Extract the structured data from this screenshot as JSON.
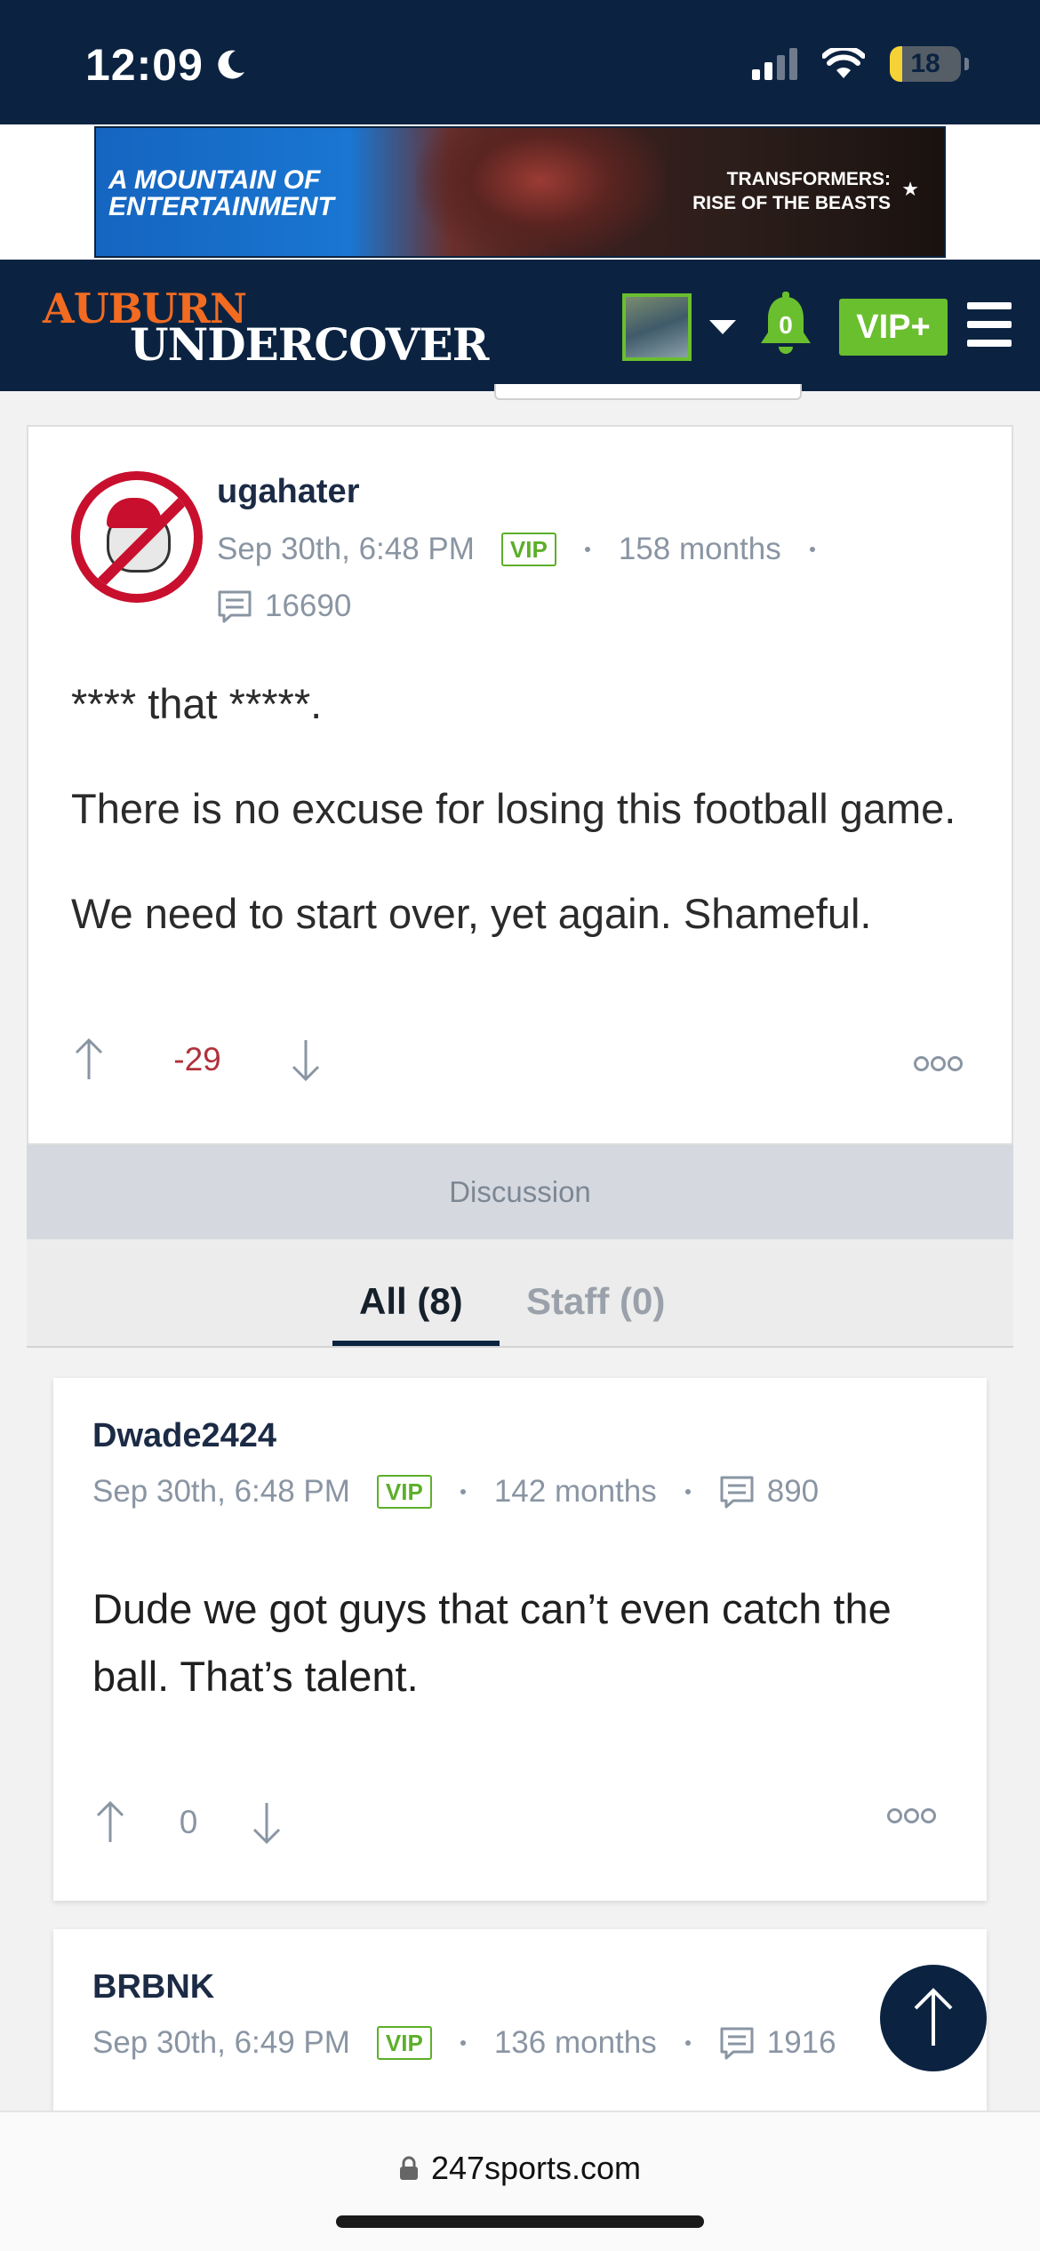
{
  "status_bar": {
    "time": "12:09",
    "battery": "18"
  },
  "ad": {
    "left_text": "A MOUNTAIN OF ENTERTAINMENT",
    "right_text_line1": "TRANSFORMERS:",
    "right_text_line2": "RISE OF THE BEASTS"
  },
  "site": {
    "logo_top": "AUBURN",
    "logo_bottom": "UNDERCOVER",
    "notification_count": "0",
    "vip_button": "VIP+"
  },
  "post": {
    "username": "ugahater",
    "timestamp": "Sep 30th, 6:48 PM",
    "badge": "VIP",
    "tenure": "158 months",
    "post_count": "16690",
    "body_line1": "**** that *****.",
    "body_line2": "There is no excuse for losing this football game.",
    "body_line3": "We need to start over, yet again. Shameful.",
    "vote_score": "-29",
    "score_color": "#b0323c"
  },
  "discussion": {
    "header": "Discussion",
    "tabs": [
      {
        "label": "All (8)"
      },
      {
        "label": "Staff (0)"
      }
    ]
  },
  "comments": [
    {
      "username": "Dwade2424",
      "timestamp": "Sep 30th, 6:48 PM",
      "badge": "VIP",
      "tenure": "142 months",
      "post_count": "890",
      "body": "Dude we got guys that can’t even catch the ball. That’s talent.",
      "vote_score": "0"
    },
    {
      "username": "BRBNK",
      "timestamp": "Sep 30th, 6:49 PM",
      "badge": "VIP",
      "tenure": "136 months",
      "post_count": "1916"
    }
  ],
  "browser": {
    "url": "247sports.com"
  },
  "colors": {
    "navy": "#0b2341",
    "orange": "#f26b21",
    "green": "#6abf2e"
  }
}
